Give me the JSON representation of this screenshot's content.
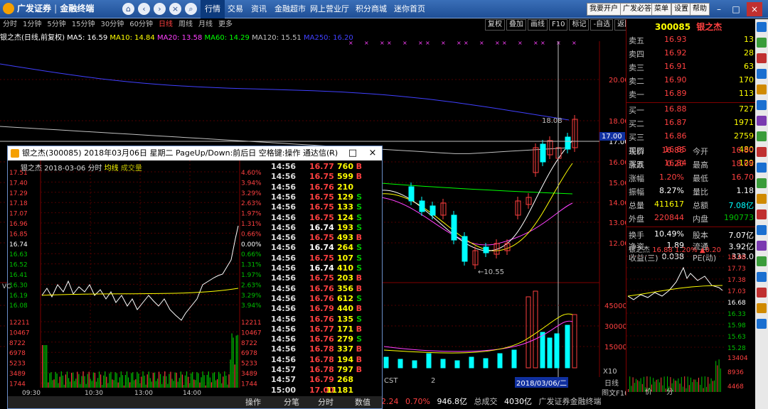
{
  "app": {
    "logo_text": "广发证券",
    "subtitle": "金融终端"
  },
  "menu": [
    "行情",
    "交易",
    "资讯",
    "金融超市",
    "网上营业厅",
    "积分商城",
    "迷你首页"
  ],
  "right_buttons": [
    "我要开户",
    "广发必答",
    "菜单",
    "设置",
    "帮助"
  ],
  "period_tabs": [
    "分时",
    "1分钟",
    "5分钟",
    "15分钟",
    "30分钟",
    "60分钟",
    "日线",
    "周线",
    "月线",
    "更多"
  ],
  "period_selected": "日线",
  "chart_tools": [
    "复权",
    "叠加",
    "画线",
    "F10",
    "标记",
    "-自选",
    "返回"
  ],
  "ma_bar": {
    "name": "银之杰(日线,前复权)",
    "ma5": "MA5: 16.59",
    "ma10": "MA10: 14.84",
    "ma20": "MA20: 13.58",
    "ma60": "MA60: 14.29",
    "ma120": "MA120: 15.51",
    "ma250": "MA250: 16.20"
  },
  "price_axis": [
    "20.00",
    "18.00",
    "17.00",
    "16.00",
    "15.00",
    "14.00",
    "13.00",
    "12.00"
  ],
  "high_label": "18.08",
  "low_label": "10.55",
  "current_tag": "17.00",
  "vol_axis": [
    "45000",
    "30000",
    "15000"
  ],
  "vol_unit": "X10",
  "date_label": "2018/03/06/二",
  "bottom_labels": {
    "cst": "CST",
    "tab2": "2",
    "daily": "日线",
    "f10": "图文F10",
    "l1": "价",
    "l2": "分"
  },
  "status": {
    "change": "2.24",
    "pct": "0.70%",
    "amount": "946.8亿",
    "label_total": "总成交",
    "total": "4030亿",
    "broker": "广发证券金融终端"
  },
  "stock": {
    "code": "300085",
    "name": "银之杰"
  },
  "order_book": [
    {
      "k": "卖五",
      "p": "16.93",
      "v": "13"
    },
    {
      "k": "卖四",
      "p": "16.92",
      "v": "28"
    },
    {
      "k": "卖三",
      "p": "16.91",
      "v": "63"
    },
    {
      "k": "卖二",
      "p": "16.90",
      "v": "170"
    },
    {
      "k": "卖一",
      "p": "16.89",
      "v": "113"
    },
    {
      "k": "买一",
      "p": "16.88",
      "v": "727"
    },
    {
      "k": "买二",
      "p": "16.87",
      "v": "1971"
    },
    {
      "k": "买三",
      "p": "16.86",
      "v": "2759"
    },
    {
      "k": "买四",
      "p": "16.85",
      "v": "480"
    },
    {
      "k": "买五",
      "p": "16.84",
      "v": "129"
    }
  ],
  "quote": [
    {
      "k": "现价",
      "v": "16.88",
      "k2": "今开",
      "v2": "16.80"
    },
    {
      "k": "涨跌",
      "v": "0.20",
      "k2": "最高",
      "v2": "18.08"
    },
    {
      "k": "涨幅",
      "v": "1.20%",
      "k2": "最低",
      "v2": "16.70"
    },
    {
      "k": "振幅",
      "v": "8.27%",
      "k2": "量比",
      "v2": "1.18"
    },
    {
      "k": "总量",
      "v": "411617",
      "k2": "总额",
      "v2": "7.08亿"
    },
    {
      "k": "外盘",
      "v": "220844",
      "k2": "内盘",
      "v2": "190773"
    }
  ],
  "fundamentals": [
    {
      "k": "换手",
      "v": "10.49%",
      "k2": "股本",
      "v2": "7.07亿"
    },
    {
      "k": "净资",
      "v": "1.89",
      "k2": "流通",
      "v2": "3.92亿"
    },
    {
      "k": "收益(三)",
      "v": "0.038",
      "k2": "PE(动)",
      "v2": "333.0"
    }
  ],
  "mini_header": {
    "name": "银之杰",
    "price": "16.88",
    "pct": "1.20%",
    "chg": "▲0.20"
  },
  "mini_axis": [
    "18.08",
    "17.73",
    "17.38",
    "17.03",
    "16.68",
    "16.33",
    "15.98",
    "15.63",
    "15.28"
  ],
  "mini_vol_axis": [
    "13404",
    "8936",
    "4468"
  ],
  "mini_tabs": [
    "价",
    "分"
  ],
  "popup": {
    "title": "银之杰(300085) 2018年03月06日 星期二 PageUp/Down:前后日 空格键:操作 通达信(R)",
    "subtitle": "银之杰  2018-03-06 分时",
    "legend_avg": "均线",
    "legend_vol": "成交量",
    "left_axis": [
      "17.51",
      "17.40",
      "17.29",
      "17.18",
      "17.07",
      "16.96",
      "16.85",
      "16.74",
      "16.63",
      "16.52",
      "16.41",
      "16.30",
      "16.19",
      "16.08",
      "12211",
      "10467",
      "8722",
      "6978",
      "5233",
      "3489",
      "1744"
    ],
    "right_axis": [
      "4.60%",
      "3.94%",
      "3.29%",
      "2.63%",
      "1.97%",
      "1.31%",
      "0.66%",
      "0.00%",
      "0.66%",
      "1.31%",
      "1.97%",
      "2.63%",
      "3.29%",
      "3.94%",
      "12211",
      "10467",
      "8722",
      "6978",
      "5233",
      "3489",
      "1744"
    ],
    "time_axis": [
      "09:30",
      "10:30",
      "13:00",
      "14:00"
    ],
    "trades": [
      [
        "14:56",
        "16.77",
        "760",
        "B"
      ],
      [
        "14:56",
        "16.75",
        "599",
        "B"
      ],
      [
        "14:56",
        "16.76",
        "210",
        ""
      ],
      [
        "14:56",
        "16.75",
        "129",
        "S"
      ],
      [
        "14:56",
        "16.75",
        "133",
        "S"
      ],
      [
        "14:56",
        "16.75",
        "124",
        "S"
      ],
      [
        "14:56",
        "16.74",
        "193",
        "S"
      ],
      [
        "14:56",
        "16.75",
        "493",
        "B"
      ],
      [
        "14:56",
        "16.74",
        "264",
        "S"
      ],
      [
        "14:56",
        "16.75",
        "107",
        "S"
      ],
      [
        "14:56",
        "16.74",
        "410",
        "S"
      ],
      [
        "14:56",
        "16.75",
        "203",
        "B"
      ],
      [
        "14:56",
        "16.76",
        "356",
        "B"
      ],
      [
        "14:56",
        "16.76",
        "612",
        "S"
      ],
      [
        "14:56",
        "16.79",
        "440",
        "B"
      ],
      [
        "14:56",
        "16.76",
        "135",
        "S"
      ],
      [
        "14:56",
        "16.77",
        "171",
        "B"
      ],
      [
        "14:56",
        "16.76",
        "279",
        "S"
      ],
      [
        "14:56",
        "16.78",
        "337",
        "B"
      ],
      [
        "14:56",
        "16.78",
        "194",
        "B"
      ],
      [
        "14:57",
        "16.78",
        "797",
        "B"
      ],
      [
        "14:57",
        "16.79",
        "268",
        ""
      ],
      [
        "15:00",
        "17.00",
        "11181",
        ""
      ]
    ],
    "tabs": [
      "操作",
      "分笔",
      "分时",
      "数值"
    ],
    "vol_side_label": "VC"
  },
  "colors": {
    "up": "#ff4040",
    "down": "#00ffff",
    "ma5": "#ffffff",
    "ma10": "#ffff00",
    "ma20": "#ff40ff",
    "ma60": "#00ff00",
    "ma120": "#c0c0c0",
    "ma250": "#4040ff"
  }
}
